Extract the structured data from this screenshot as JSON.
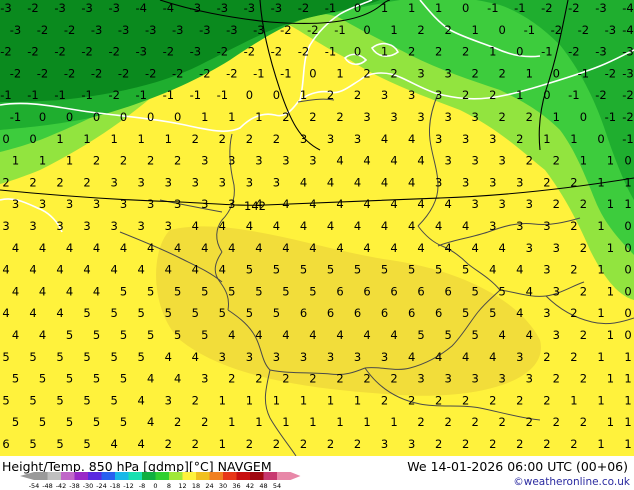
{
  "colors": {
    "very_cold": "#0a8a1e",
    "cold": "#1fae2f",
    "cool": "#3dcc3d",
    "mild": "#92e43f",
    "warm": "#fff23c",
    "warmer": "#f2dd3a",
    "coast": "#ffffff",
    "border": "#4a4a4a"
  },
  "map": {
    "contour_label": "142"
  },
  "footer": {
    "title": "Height/Temp. 850 hPa [gdmp][°C] NAVGEM",
    "date": "We 14-01-2026 06:00 UTC (00+06)",
    "credit": "©weatheronline.co.uk"
  },
  "scale": {
    "tick_labels": [
      "-54",
      "-48",
      "-42",
      "-38",
      "-30",
      "-24",
      "-18",
      "-12",
      "-8",
      "0",
      "8",
      "12",
      "18",
      "24",
      "30",
      "36",
      "42",
      "48",
      "54"
    ],
    "colors": [
      "#9a9a9a",
      "#bfbfbf",
      "#c068c8",
      "#9a28c8",
      "#5a28e0",
      "#2860f0",
      "#18b8e8",
      "#18e0b0",
      "#10b040",
      "#30d030",
      "#a0e838",
      "#fff23c",
      "#f0c020",
      "#f08020",
      "#e83818",
      "#c81010",
      "#a00810",
      "#c83870",
      "#e888a8"
    ]
  },
  "temperature_values": [
    [
      "-3",
      "-2",
      "-3",
      "-3",
      "-3",
      "-4",
      "-4",
      "-3",
      "-3",
      "-3",
      "-3",
      "-2",
      "-1",
      "0",
      "1",
      "1",
      "1",
      "0",
      "-1",
      "-1",
      "-2",
      "-2",
      "-3",
      "-4"
    ],
    [
      "-3",
      "-2",
      "-2",
      "-3",
      "-3",
      "-3",
      "-3",
      "-3",
      "-3",
      "-3",
      "-2",
      "-2",
      "-1",
      "0",
      "1",
      "2",
      "2",
      "1",
      "0",
      "-1",
      "-2",
      "-2",
      "-3",
      "-4"
    ],
    [
      "-2",
      "-2",
      "-2",
      "-2",
      "-2",
      "-3",
      "-2",
      "-3",
      "-2",
      "-2",
      "-2",
      "-2",
      "-1",
      "0",
      "1",
      "2",
      "2",
      "2",
      "1",
      "0",
      "-1",
      "-2",
      "-3",
      "-3"
    ],
    [
      "-2",
      "-2",
      "-2",
      "-2",
      "-2",
      "-2",
      "-2",
      "-2",
      "-2",
      "-1",
      "-1",
      "0",
      "1",
      "2",
      "2",
      "3",
      "3",
      "2",
      "2",
      "1",
      "0",
      "-1",
      "-2",
      "-3"
    ],
    [
      "-1",
      "-1",
      "-1",
      "-1",
      "-2",
      "-1",
      "-1",
      "-1",
      "-1",
      "0",
      "0",
      "1",
      "2",
      "2",
      "3",
      "3",
      "3",
      "2",
      "2",
      "1",
      "0",
      "-1",
      "-2",
      "-2"
    ],
    [
      "-1",
      "0",
      "0",
      "0",
      "0",
      "0",
      "0",
      "1",
      "1",
      "1",
      "2",
      "2",
      "2",
      "3",
      "3",
      "3",
      "3",
      "3",
      "2",
      "2",
      "1",
      "0",
      "-1",
      "-2"
    ],
    [
      "0",
      "0",
      "1",
      "1",
      "1",
      "1",
      "1",
      "2",
      "2",
      "2",
      "2",
      "3",
      "3",
      "3",
      "4",
      "4",
      "3",
      "3",
      "3",
      "2",
      "1",
      "1",
      "0",
      "-1"
    ],
    [
      "1",
      "1",
      "1",
      "2",
      "2",
      "2",
      "2",
      "3",
      "3",
      "3",
      "3",
      "3",
      "4",
      "4",
      "4",
      "4",
      "3",
      "3",
      "3",
      "2",
      "2",
      "1",
      "1",
      "0"
    ],
    [
      "2",
      "2",
      "2",
      "2",
      "3",
      "3",
      "3",
      "3",
      "3",
      "3",
      "3",
      "4",
      "4",
      "4",
      "4",
      "4",
      "3",
      "3",
      "3",
      "3",
      "2",
      "2",
      "1",
      "1"
    ],
    [
      "3",
      "3",
      "3",
      "3",
      "3",
      "3",
      "3",
      "3",
      "3",
      "4",
      "4",
      "4",
      "4",
      "4",
      "4",
      "4",
      "4",
      "3",
      "3",
      "3",
      "2",
      "2",
      "1",
      "1"
    ],
    [
      "3",
      "3",
      "3",
      "3",
      "3",
      "3",
      "3",
      "4",
      "4",
      "4",
      "4",
      "4",
      "4",
      "4",
      "4",
      "4",
      "4",
      "4",
      "3",
      "3",
      "3",
      "2",
      "1",
      "0"
    ],
    [
      "4",
      "4",
      "4",
      "4",
      "4",
      "4",
      "4",
      "4",
      "4",
      "4",
      "4",
      "4",
      "4",
      "4",
      "4",
      "4",
      "4",
      "4",
      "4",
      "3",
      "3",
      "2",
      "1",
      "0"
    ],
    [
      "4",
      "4",
      "4",
      "4",
      "4",
      "4",
      "4",
      "4",
      "4",
      "5",
      "5",
      "5",
      "5",
      "5",
      "5",
      "5",
      "5",
      "5",
      "4",
      "4",
      "3",
      "2",
      "1",
      "0"
    ],
    [
      "4",
      "4",
      "4",
      "4",
      "5",
      "5",
      "5",
      "5",
      "5",
      "5",
      "5",
      "5",
      "6",
      "6",
      "6",
      "6",
      "6",
      "5",
      "5",
      "4",
      "3",
      "2",
      "1",
      "0"
    ],
    [
      "4",
      "4",
      "4",
      "5",
      "5",
      "5",
      "5",
      "5",
      "5",
      "5",
      "5",
      "6",
      "6",
      "6",
      "6",
      "6",
      "6",
      "5",
      "5",
      "4",
      "3",
      "2",
      "1",
      "0"
    ],
    [
      "4",
      "4",
      "5",
      "5",
      "5",
      "5",
      "5",
      "5",
      "4",
      "4",
      "4",
      "4",
      "4",
      "4",
      "4",
      "5",
      "5",
      "5",
      "4",
      "4",
      "3",
      "2",
      "1",
      "0"
    ],
    [
      "5",
      "5",
      "5",
      "5",
      "5",
      "5",
      "4",
      "4",
      "3",
      "3",
      "3",
      "3",
      "3",
      "3",
      "3",
      "4",
      "4",
      "4",
      "4",
      "3",
      "2",
      "2",
      "1",
      "1"
    ],
    [
      "5",
      "5",
      "5",
      "5",
      "5",
      "4",
      "4",
      "3",
      "2",
      "2",
      "2",
      "2",
      "2",
      "2",
      "2",
      "3",
      "3",
      "3",
      "3",
      "3",
      "2",
      "2",
      "1",
      "1"
    ],
    [
      "5",
      "5",
      "5",
      "5",
      "5",
      "4",
      "3",
      "2",
      "1",
      "1",
      "1",
      "1",
      "1",
      "1",
      "2",
      "2",
      "2",
      "2",
      "2",
      "2",
      "2",
      "1",
      "1",
      "1"
    ],
    [
      "5",
      "5",
      "5",
      "5",
      "5",
      "4",
      "2",
      "2",
      "1",
      "1",
      "1",
      "1",
      "1",
      "1",
      "1",
      "2",
      "2",
      "2",
      "2",
      "2",
      "2",
      "2",
      "1",
      "1"
    ],
    [
      "6",
      "5",
      "5",
      "5",
      "4",
      "4",
      "2",
      "2",
      "1",
      "2",
      "2",
      "2",
      "2",
      "2",
      "3",
      "3",
      "2",
      "2",
      "2",
      "2",
      "2",
      "2",
      "1",
      "1"
    ]
  ]
}
